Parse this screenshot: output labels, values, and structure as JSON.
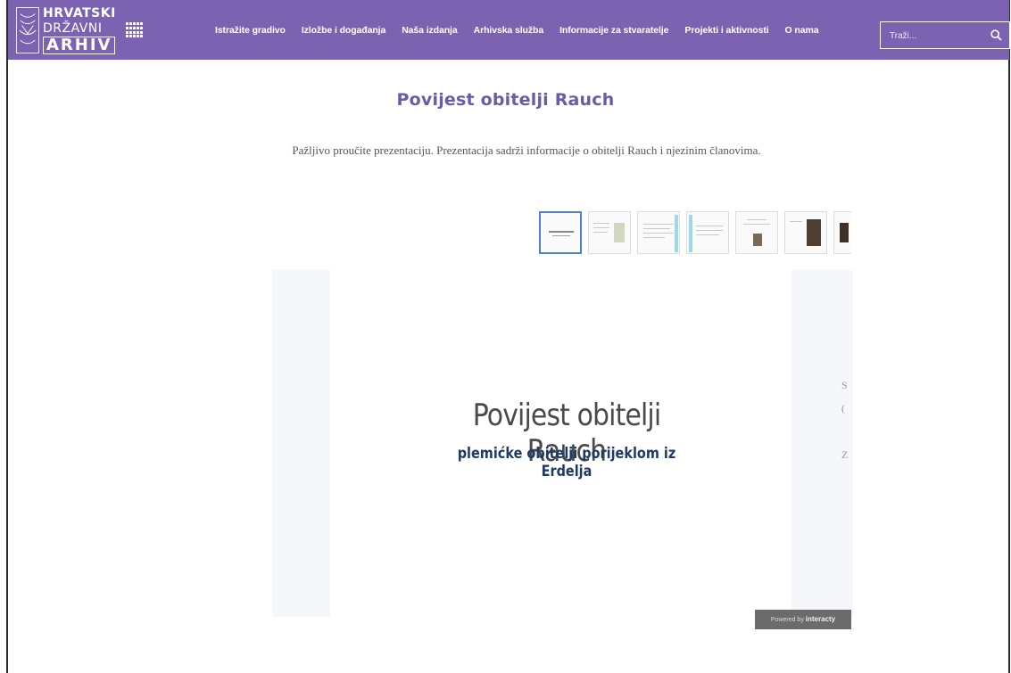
{
  "nav": {
    "logo": {
      "line1": "HRVATSKI",
      "line2": "DRŽAVNI",
      "line3": "ARHIV"
    },
    "menu": [
      "Istražite gradivo",
      "Izložbe i događanja",
      "Naša izdanja",
      "Arhivska služba",
      "Informacije za stvaratelje",
      "Projekti i aktivnosti",
      "O nama"
    ],
    "search_placeholder": "Traži..."
  },
  "page": {
    "title": "Povijest obitelji Rauch",
    "intro": "Pažljivo proučite prezentaciju. Prezentacija sadrži informacije o obitelji Rauch i njezinim članovima."
  },
  "slide": {
    "title": "Povijest obitelji Rauch",
    "subtitle": "plemićke obitelji porijeklom iz Erdelja",
    "clipped_chars": [
      "S",
      "(",
      "Z"
    ]
  },
  "powered": {
    "prefix": "Powered by",
    "brand": "interacty"
  },
  "colors": {
    "nav": "#7b63b1",
    "title": "#6a5aa8",
    "thumb_active_border": "#4f7fd4"
  },
  "icons": {
    "search": "search-icon",
    "apps": "grid-icon"
  }
}
